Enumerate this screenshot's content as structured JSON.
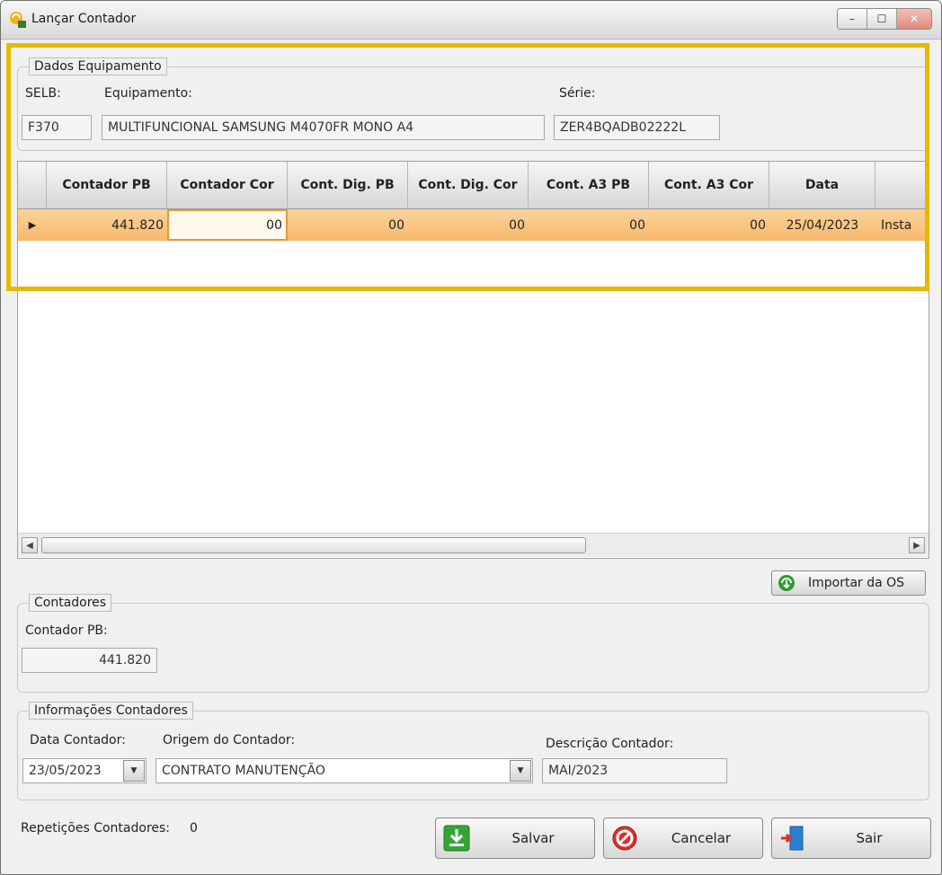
{
  "window": {
    "title": "Lançar Contador",
    "minimize": "–",
    "maximize": "☐",
    "close": "✕"
  },
  "dados_equipamento": {
    "legend": "Dados Equipamento",
    "selb_label": "SELB:",
    "selb_value": "F370",
    "equip_label": "Equipamento:",
    "equip_value": "MULTIFUNCIONAL SAMSUNG M4070FR MONO A4",
    "serie_label": "Série:",
    "serie_value": "ZER4BQADB02222L"
  },
  "grid": {
    "columns": [
      "",
      "Contador PB",
      "Contador Cor",
      "Cont. Dig. PB",
      "Cont. Dig. Cor",
      "Cont. A3 PB",
      "Cont. A3 Cor",
      "Data",
      ""
    ],
    "row": {
      "indicator": "▶",
      "cells": [
        "441.820",
        "00",
        "00",
        "00",
        "00",
        "00",
        "25/04/2023",
        "Insta"
      ]
    }
  },
  "import_button": {
    "label": "Importar da OS",
    "icon": "green-refresh-icon"
  },
  "contadores": {
    "legend": "Contadores",
    "pb_label": "Contador PB:",
    "pb_value": "441.820"
  },
  "info_contadores": {
    "legend": "Informações Contadores",
    "data_label": "Data Contador:",
    "data_value": "23/05/2023",
    "origem_label": "Origem do Contador:",
    "origem_value": "CONTRATO MANUTENÇÃO",
    "desc_label": "Descrição Contador:",
    "desc_value": "MAI/2023"
  },
  "footer": {
    "repeticoes_label": "Repetições Contadores:",
    "repeticoes_value": "0",
    "salvar": "Salvar",
    "cancelar": "Cancelar",
    "sair": "Sair"
  },
  "colors": {
    "highlight": "#e6b800",
    "row_selected": "#f7b96b"
  }
}
